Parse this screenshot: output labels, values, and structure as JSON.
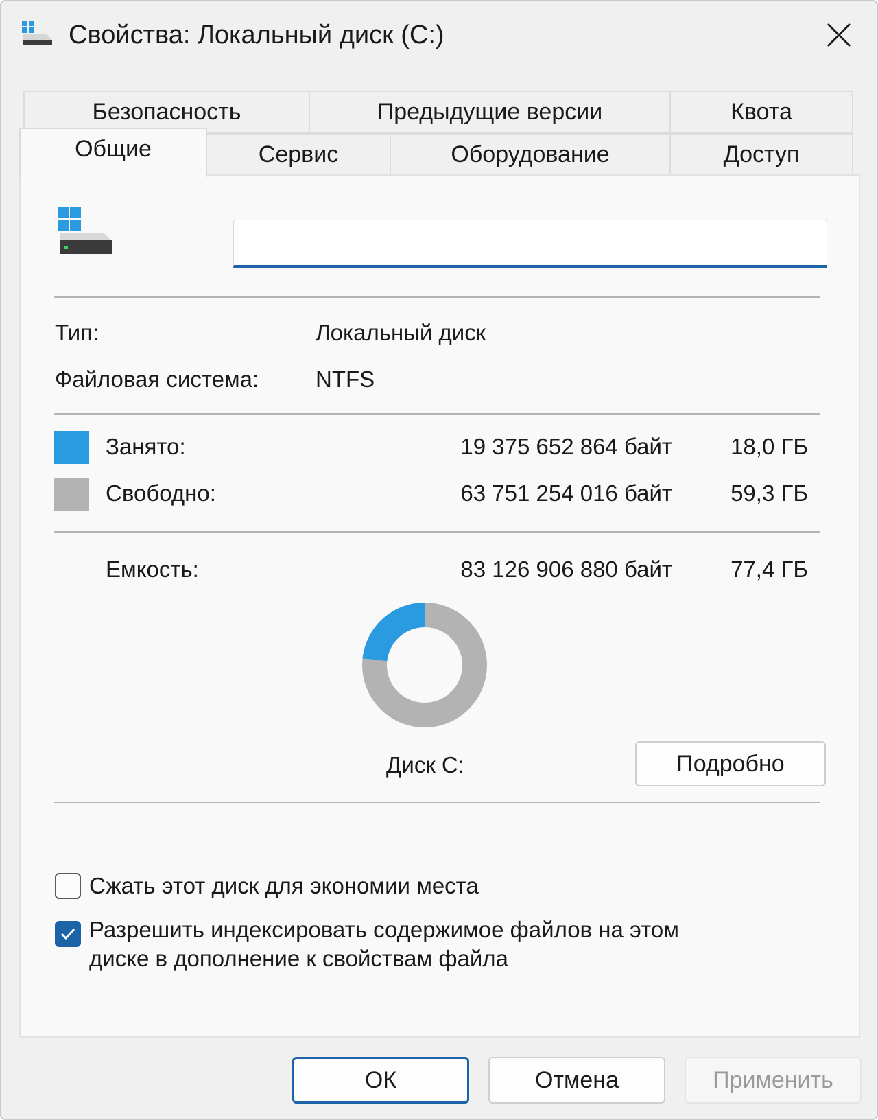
{
  "window": {
    "title": "Свойства: Локальный диск (C:)"
  },
  "tabs": {
    "row1": [
      {
        "label": "Безопасность"
      },
      {
        "label": "Предыдущие версии"
      },
      {
        "label": "Квота"
      }
    ],
    "row2": [
      {
        "label": "Общие",
        "active": true
      },
      {
        "label": "Сервис"
      },
      {
        "label": "Оборудование"
      },
      {
        "label": "Доступ"
      }
    ]
  },
  "general": {
    "drive_icon": "drive-icon",
    "name_value": "",
    "type_label": "Тип:",
    "type_value": "Локальный диск",
    "fs_label": "Файловая система:",
    "fs_value": "NTFS",
    "used": {
      "label": "Занято:",
      "bytes": "19 375 652 864 байт",
      "size": "18,0 ГБ",
      "color": "#2a9be0"
    },
    "free": {
      "label": "Свободно:",
      "bytes": "63 751 254 016 байт",
      "size": "59,3 ГБ",
      "color": "#b3b3b3"
    },
    "capacity": {
      "label": "Емкость:",
      "bytes": "83 126 906 880 байт",
      "size": "77,4 ГБ"
    },
    "used_fraction": 0.233,
    "disk_label": "Диск C:",
    "details_button": "Подробно",
    "compress_label": "Сжать этот диск для экономии места",
    "compress_checked": false,
    "index_label_line1": "Разрешить индексировать содержимое файлов на этом",
    "index_label_line2": "диске в дополнение к свойствам файла",
    "index_checked": true
  },
  "footer": {
    "ok": "ОК",
    "cancel": "Отмена",
    "apply": "Применить"
  },
  "colors": {
    "accent": "#1c63a8",
    "used": "#2a9be0",
    "free": "#b3b3b3"
  }
}
